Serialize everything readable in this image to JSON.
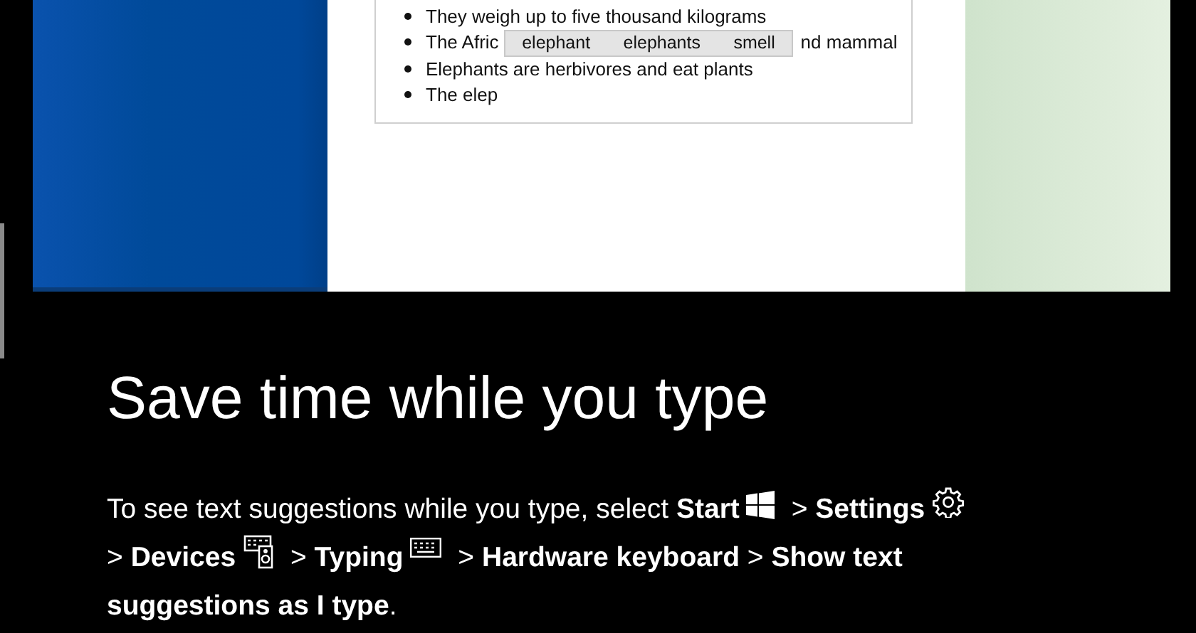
{
  "document": {
    "bullets": [
      {
        "text": "They weigh up to five thousand kilograms"
      },
      {
        "text": "The Afric",
        "text_after": "nd mammal"
      },
      {
        "text": "Elephants are herbivores and eat plants"
      },
      {
        "text": "The elep"
      }
    ],
    "suggestions": [
      {
        "label": "elephant"
      },
      {
        "label": "elephants"
      },
      {
        "label": "smell"
      }
    ]
  },
  "title": "Save time while you type",
  "instructions": [
    [
      {
        "text": "To see text suggestions while you type, select **Start**",
        "kind": "windows"
      },
      {
        "text": " > **Settings**",
        "kind": "gear"
      }
    ],
    [
      {
        "text": "> **Devices**",
        "kind": "devices"
      },
      {
        "text": " > **Typing**",
        "kind": "keyboard"
      },
      {
        "text": " > **Hardware keyboard** > **Show text**"
      }
    ],
    [
      {
        "text": "**suggestions as I type**."
      }
    ]
  ]
}
